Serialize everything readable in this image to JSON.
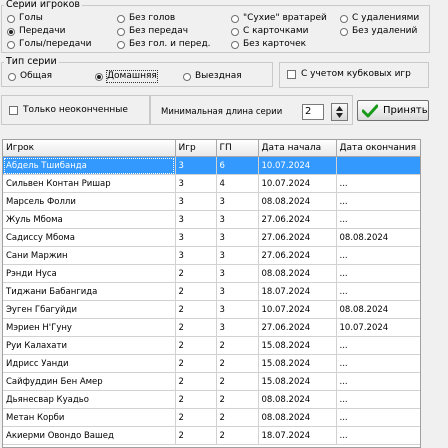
{
  "series_group": {
    "title": "Серии игроков",
    "options": [
      "Голы",
      "Без голов",
      "\"Сухие\" вратарей",
      "С удалениями",
      "Передачи",
      "Без передач",
      "С карточками",
      "Без удалений",
      "Голы/передачи",
      "Без гол. и перед.",
      "Без карточек"
    ],
    "selected": "Передачи"
  },
  "type_group": {
    "title": "Тип серии",
    "options": [
      "Общая",
      "Домашняя",
      "Выездная"
    ],
    "selected": "Домашняя"
  },
  "cup_checkbox": {
    "label": "С учетом кубковых игр",
    "checked": false
  },
  "unfinished_checkbox": {
    "label": "Только неоконченные",
    "checked": false
  },
  "min_length": {
    "label": "Минимальная длина серии",
    "value": "2"
  },
  "accept_button": {
    "label": "Принять"
  },
  "colors": {
    "selection": "#3399ff",
    "accept_check": "#1a9a1a"
  },
  "table": {
    "columns": [
      "Игрок",
      "Игр",
      "ГП",
      "Дата начала",
      "Дата окончания"
    ],
    "selected_row": 0,
    "rows": [
      [
        "Абдель Тшибанда",
        "3",
        "6",
        "10.07.2024",
        ""
      ],
      [
        "Сильвен Контан Ришар",
        "3",
        "4",
        "10.07.2024",
        "..."
      ],
      [
        "Марсель Фолли",
        "3",
        "3",
        "08.08.2024",
        "..."
      ],
      [
        "Жуль Мбома",
        "3",
        "3",
        "27.06.2024",
        "..."
      ],
      [
        "Садиссу Мбома",
        "3",
        "3",
        "27.06.2024",
        "08.08.2024"
      ],
      [
        "Сани Маржин",
        "3",
        "3",
        "27.06.2024",
        "..."
      ],
      [
        "Рэнди Нуса",
        "2",
        "3",
        "08.08.2024",
        "..."
      ],
      [
        "Тиджани Бабангида",
        "2",
        "3",
        "18.07.2024",
        "..."
      ],
      [
        "Эуген Гбагуйди",
        "2",
        "3",
        "10.07.2024",
        "08.08.2024"
      ],
      [
        "Мэриен Н'Гуну",
        "2",
        "3",
        "27.06.2024",
        "10.07.2024"
      ],
      [
        "Руи Калахати",
        "2",
        "2",
        "15.08.2024",
        "..."
      ],
      [
        "Идрисс Уанди",
        "2",
        "2",
        "15.08.2024",
        "..."
      ],
      [
        "Сайфуддин Бен Амер",
        "2",
        "2",
        "15.08.2024",
        "..."
      ],
      [
        "Дьянесвар Куадьо",
        "2",
        "2",
        "08.08.2024",
        "..."
      ],
      [
        "Метан Корби",
        "2",
        "2",
        "08.08.2024",
        "..."
      ],
      [
        "Акиерми Овондо Вашед",
        "2",
        "2",
        "18.07.2024",
        "..."
      ]
    ]
  }
}
